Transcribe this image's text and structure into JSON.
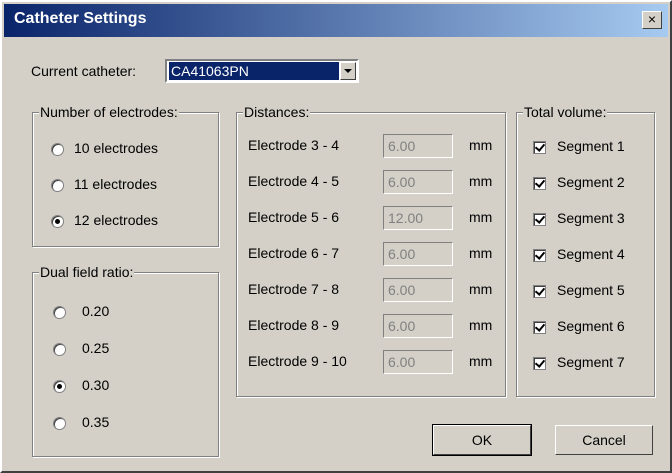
{
  "window": {
    "title": "Catheter Settings",
    "close_symbol": "×"
  },
  "catheter": {
    "label": "Current catheter:",
    "value": "CA41063PN"
  },
  "electrodes": {
    "title": "Number of electrodes:",
    "options": [
      {
        "label": "10 electrodes",
        "selected": false
      },
      {
        "label": "11 electrodes",
        "selected": false
      },
      {
        "label": "12 electrodes",
        "selected": true
      }
    ]
  },
  "dual_field": {
    "title": "Dual field ratio:",
    "options": [
      {
        "label": "0.20",
        "selected": false
      },
      {
        "label": "0.25",
        "selected": false
      },
      {
        "label": "0.30",
        "selected": true
      },
      {
        "label": "0.35",
        "selected": false
      }
    ]
  },
  "distances": {
    "title": "Distances:",
    "unit": "mm",
    "rows": [
      {
        "label": "Electrode 3 - 4",
        "value": "6.00"
      },
      {
        "label": "Electrode 4 - 5",
        "value": "6.00"
      },
      {
        "label": "Electrode 5 - 6",
        "value": "12.00"
      },
      {
        "label": "Electrode 6 - 7",
        "value": "6.00"
      },
      {
        "label": "Electrode 7 - 8",
        "value": "6.00"
      },
      {
        "label": "Electrode 8 - 9",
        "value": "6.00"
      },
      {
        "label": "Electrode 9 - 10",
        "value": "6.00"
      }
    ]
  },
  "total_volume": {
    "title": "Total volume:",
    "segments": [
      {
        "label": "Segment 1",
        "checked": true
      },
      {
        "label": "Segment 2",
        "checked": true
      },
      {
        "label": "Segment 3",
        "checked": true
      },
      {
        "label": "Segment 4",
        "checked": true
      },
      {
        "label": "Segment 5",
        "checked": true
      },
      {
        "label": "Segment 6",
        "checked": true
      },
      {
        "label": "Segment 7",
        "checked": true
      }
    ]
  },
  "buttons": {
    "ok": "OK",
    "cancel": "Cancel"
  }
}
